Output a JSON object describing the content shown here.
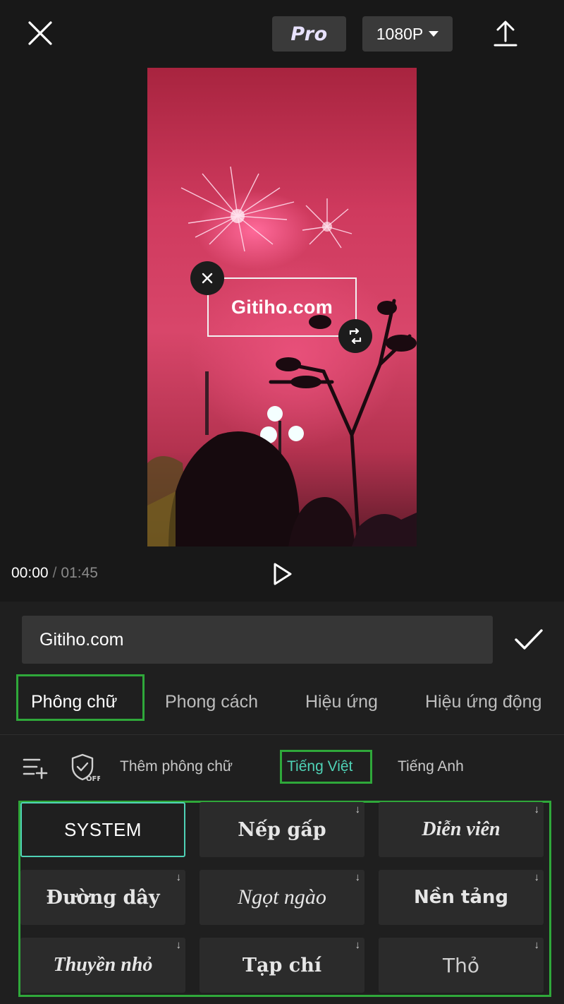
{
  "header": {
    "pro_label": "Pro",
    "resolution_label": "1080P"
  },
  "preview": {
    "overlay_text": "Gitiho.com"
  },
  "playback": {
    "current_time": "00:00",
    "separator": "/",
    "total_time": "01:45"
  },
  "editor": {
    "text_value": "Gitiho.com"
  },
  "tabs": [
    {
      "label": "Phông chữ",
      "active": true
    },
    {
      "label": "Phong cách",
      "active": false
    },
    {
      "label": "Hiệu ứng",
      "active": false
    },
    {
      "label": "Hiệu ứng động",
      "active": false
    }
  ],
  "font_toolbar": {
    "add_font_label": "Thêm phông chữ",
    "filter_vietnamese": "Tiếng Việt",
    "filter_english": "Tiếng Anh"
  },
  "fonts": [
    {
      "label": "SYSTEM",
      "selected": true,
      "download": false
    },
    {
      "label": "Nếp gấp",
      "selected": false,
      "download": true
    },
    {
      "label": "Diễn viên",
      "selected": false,
      "download": true
    },
    {
      "label": "Đường dây",
      "selected": false,
      "download": true
    },
    {
      "label": "Ngọt ngào",
      "selected": false,
      "download": true
    },
    {
      "label": "Nền tảng",
      "selected": false,
      "download": true
    },
    {
      "label": "Thuyền nhỏ",
      "selected": false,
      "download": true
    },
    {
      "label": "Tạp chí",
      "selected": false,
      "download": true
    },
    {
      "label": "Thỏ",
      "selected": false,
      "download": true
    }
  ],
  "download_glyph": "↓",
  "colors": {
    "accent": "#4fd2b6",
    "highlight_box": "#2fa83a",
    "background": "#181818"
  }
}
